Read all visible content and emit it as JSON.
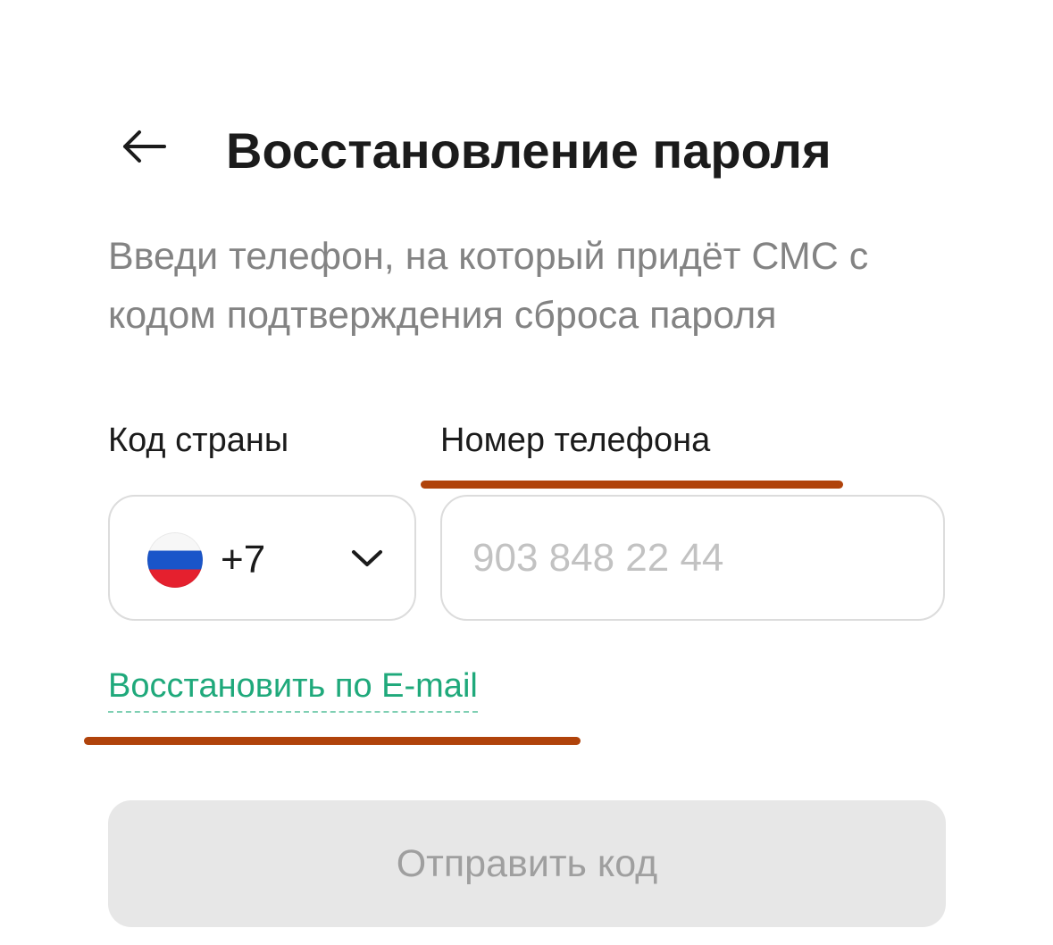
{
  "header": {
    "back_icon": "arrow-left-icon",
    "title": "Восстановление пароля"
  },
  "description": "Введи телефон, на который придёт СМС с кодом подтверждения сброса пароля",
  "form": {
    "country_code_label": "Код страны",
    "phone_label": "Номер телефона",
    "country": {
      "flag_icon": "russia-flag-icon",
      "code": "+7",
      "dropdown_icon": "chevron-down-icon"
    },
    "phone_input": {
      "value": "",
      "placeholder": "903 848 22 44"
    },
    "email_link": "Восстановить по E-mail",
    "submit_label": "Отправить код"
  },
  "colors": {
    "link": "#1fa97b",
    "marker": "#b0430b",
    "disabled_button_bg": "#e7e7e7",
    "disabled_button_text": "#9f9f9f"
  }
}
